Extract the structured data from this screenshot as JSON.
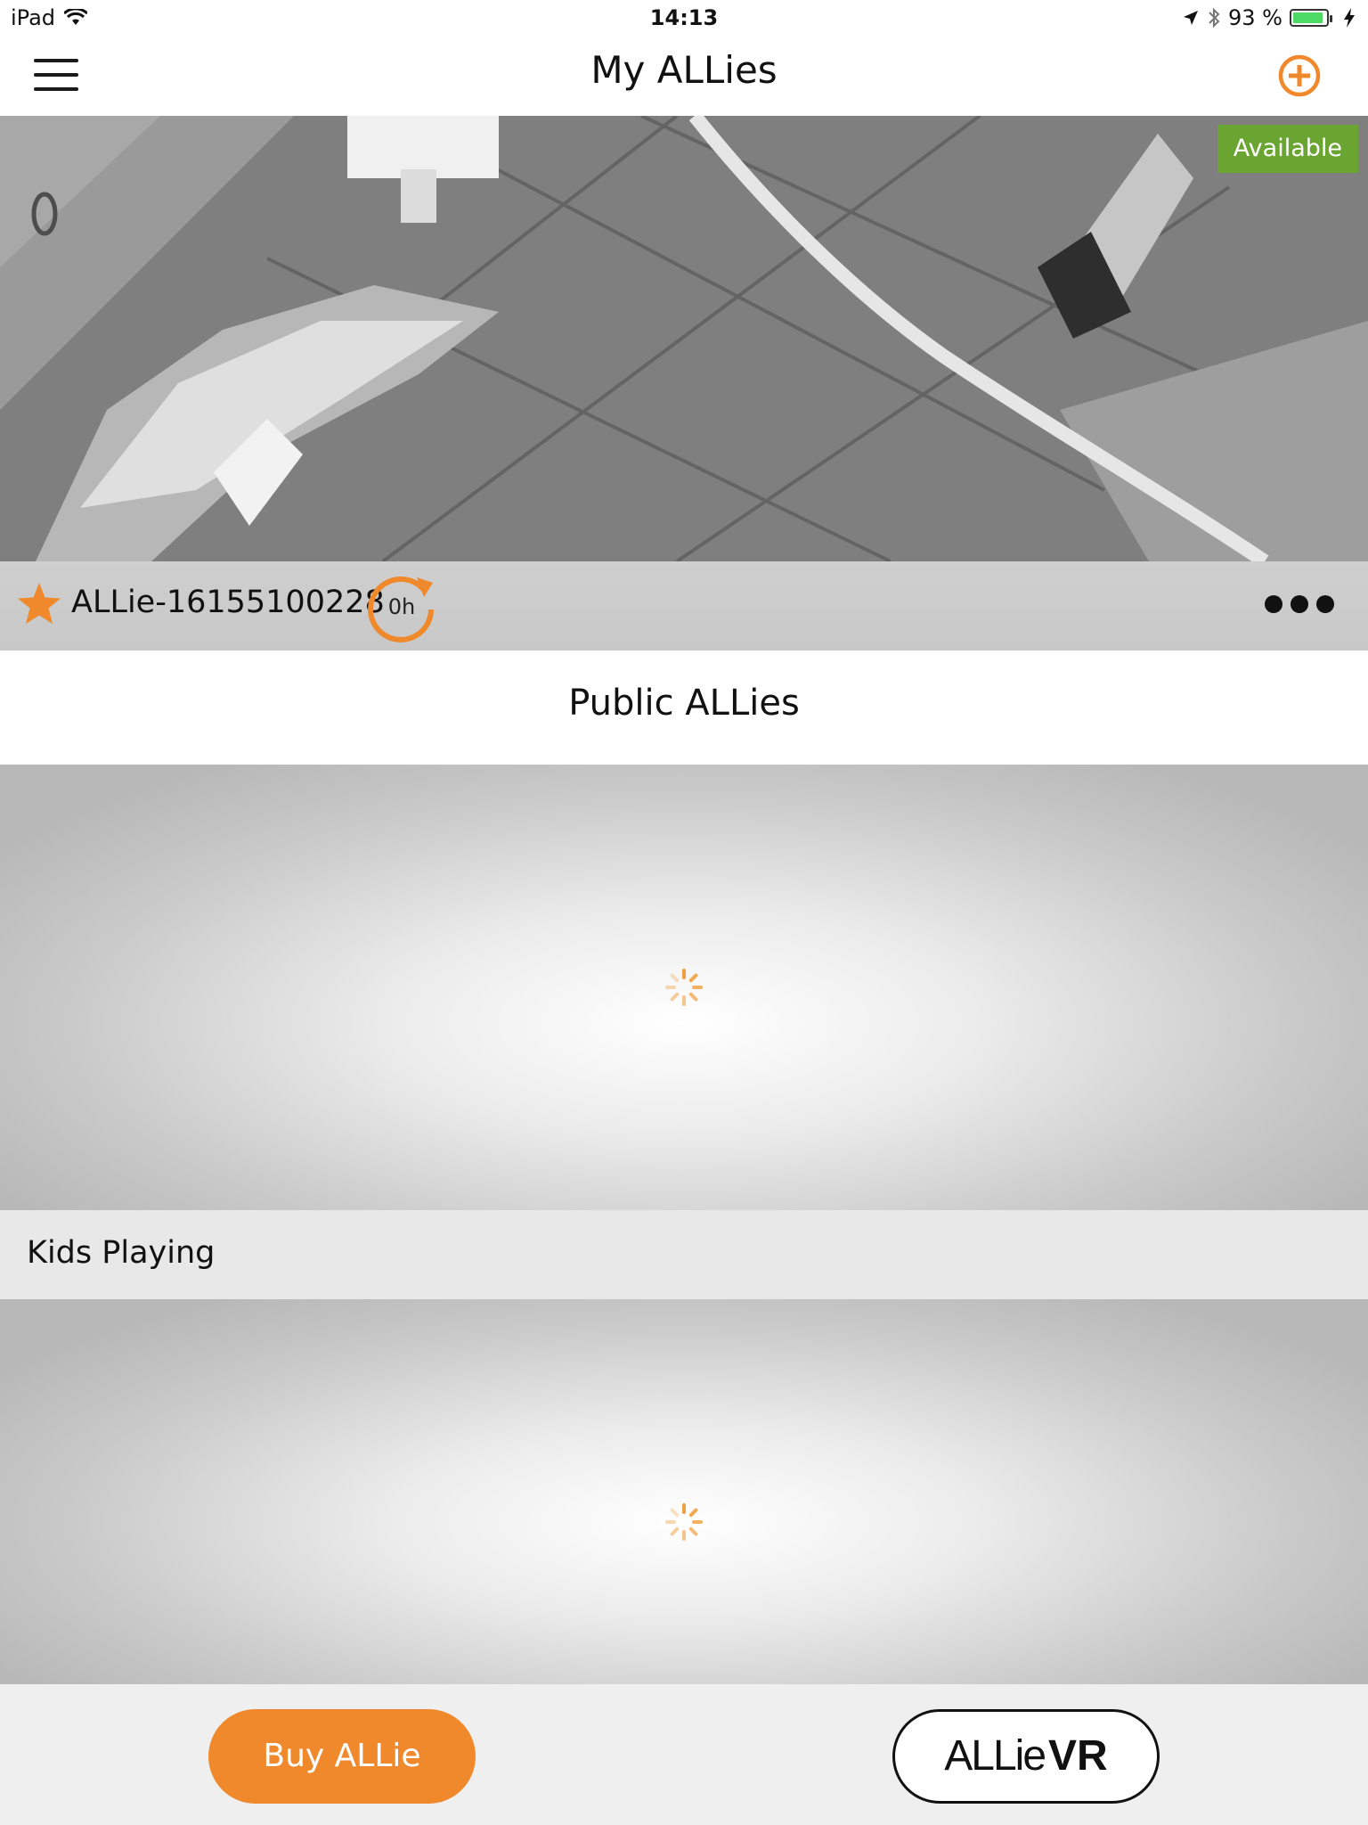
{
  "status_bar": {
    "device": "iPad",
    "time": "14:13",
    "battery": "93 %",
    "battery_level": 0.93
  },
  "nav": {
    "title": "My ALLies"
  },
  "my_allie": {
    "status_badge": "Available",
    "name": "ALLie-16155100228",
    "hours": "0h",
    "favorite": true
  },
  "public": {
    "section_title": "Public ALLies",
    "streams": [
      {
        "label": "Kids Playing"
      }
    ]
  },
  "toolbar": {
    "buy_label": "Buy  ALLie",
    "vr_logo_text": "ALLie",
    "vr_logo_suffix": "VR"
  },
  "colors": {
    "accent": "#f0892b",
    "available": "#6aa532"
  }
}
